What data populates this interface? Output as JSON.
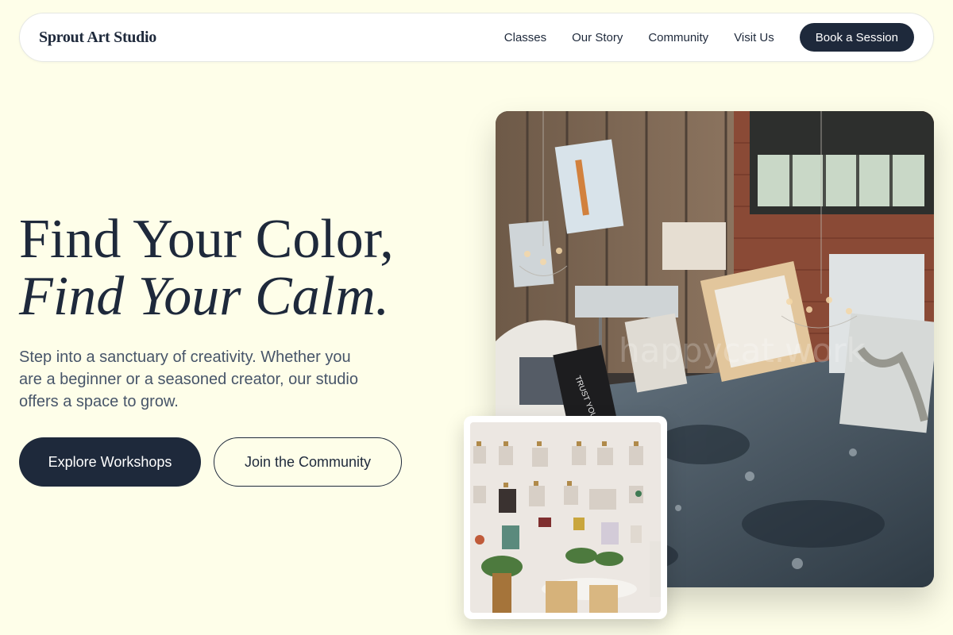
{
  "nav": {
    "brand": "Sprout Art Studio",
    "links": [
      "Classes",
      "Our Story",
      "Community",
      "Visit Us"
    ],
    "cta": "Book a Session"
  },
  "hero": {
    "title_line1": "Find Your Color,",
    "title_line2": "Find Your Calm.",
    "subtitle": "Step into a sanctuary of creativity. Whether you are a beginner or a seasoned creator, our studio offers a space to grow.",
    "primary_button": "Explore Workshops",
    "secondary_button": "Join the Community"
  },
  "images": {
    "main_sign_text": "TRUST YOUR JOURNEY",
    "watermark": "happycat.work"
  },
  "colors": {
    "background": "#fefee9",
    "ink": "#1e293b",
    "muted": "#475569"
  }
}
